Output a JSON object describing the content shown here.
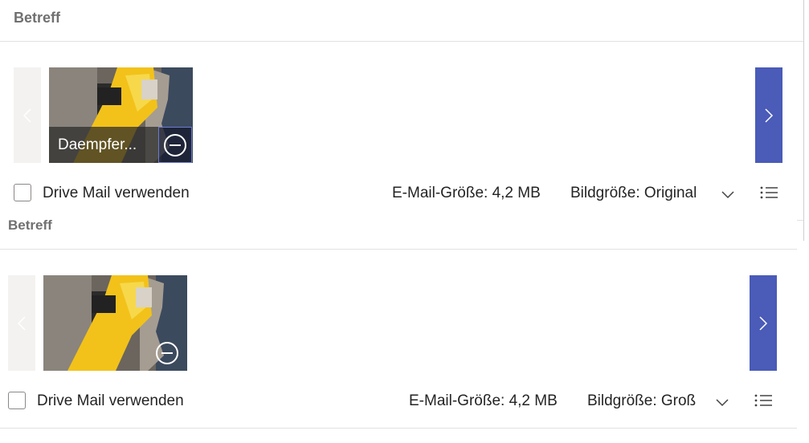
{
  "compose_top": {
    "subject_label": "Betreff",
    "attachment": {
      "caption": "Daempfer..."
    },
    "drive_mail_label": "Drive Mail verwenden",
    "email_size": "E-Mail-Größe: 4,2 MB",
    "image_size": "Bildgröße: Original"
  },
  "compose_bottom": {
    "subject_label": "Betreff",
    "drive_mail_label": "Drive Mail verwenden",
    "email_size": "E-Mail-Größe: 4,2 MB",
    "image_size": "Bildgröße: Groß"
  },
  "icons": {
    "prev": "chevron-left-icon",
    "next": "chevron-right-icon",
    "remove": "remove-circle-icon",
    "dropdown": "chevron-down-icon",
    "options": "list-icon"
  },
  "colors": {
    "next_button": "#4a5bb8",
    "prev_button": "#f3f2f1",
    "subject_text": "#707070"
  }
}
